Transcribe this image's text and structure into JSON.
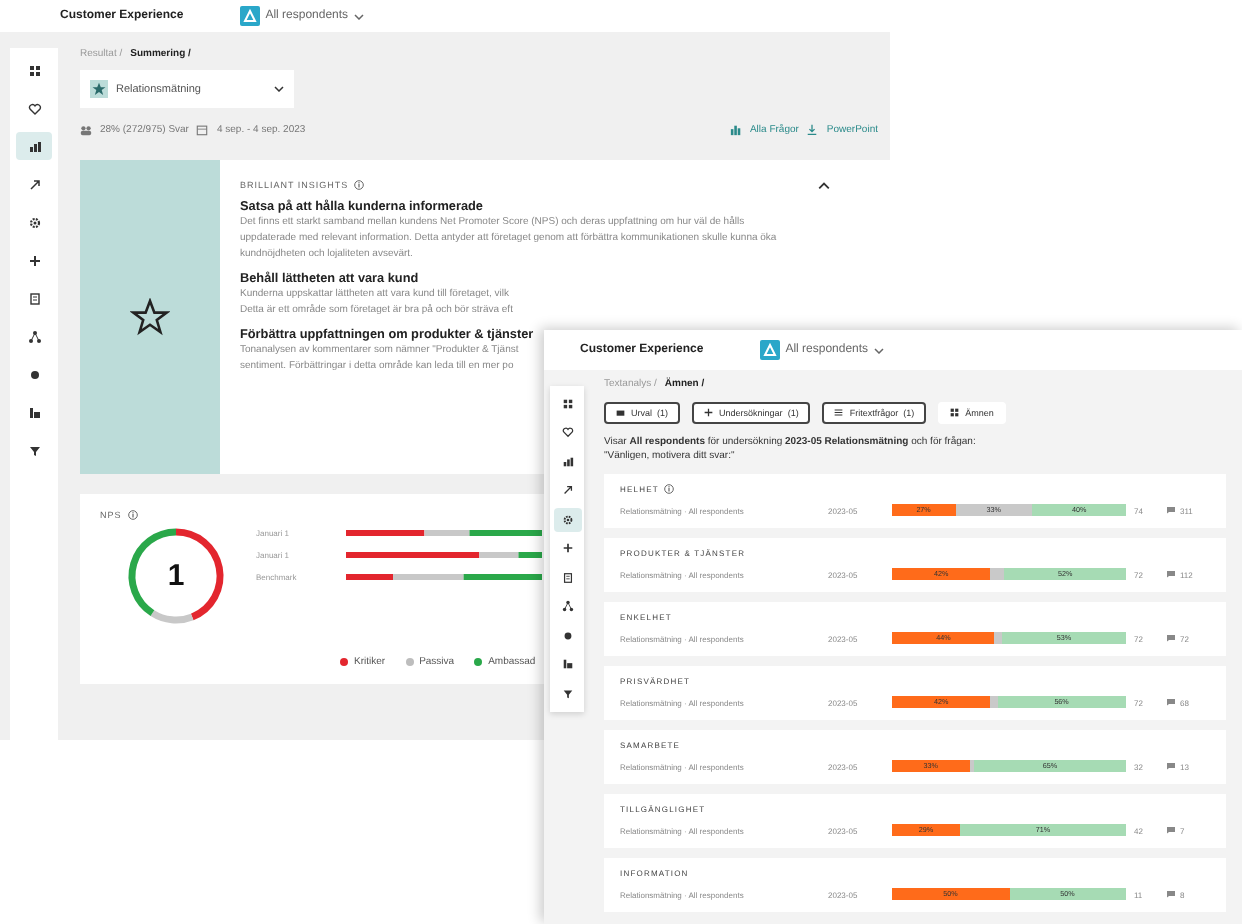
{
  "back_window": {
    "header": {
      "title": "Customer Experience",
      "filter": "All respondents"
    },
    "sidebar": {
      "items": [
        {
          "selected": false
        },
        {
          "selected": false
        },
        {
          "selected": true
        },
        {
          "selected": false
        },
        {
          "selected": false
        },
        {
          "selected": false
        },
        {
          "selected": false
        },
        {
          "selected": false
        },
        {
          "selected": false
        },
        {
          "selected": false
        },
        {
          "selected": false
        }
      ]
    },
    "breadcrumb": [
      {
        "label": "Resultat /",
        "current": false
      },
      {
        "label": "Summering /",
        "current": true
      }
    ],
    "survey_dropdown": {
      "value": "Relationsmätning"
    },
    "meta": {
      "response_rate": "28% (272/975) Svar",
      "date_range": "4 sep. - 4 sep. 2023"
    },
    "actions": [
      "Alla Frågor",
      "PowerPoint"
    ],
    "insights": {
      "title": "BRILLIANT INSIGHTS",
      "expanded": true,
      "sections": [
        {
          "heading": "Satsa på att hålla kunderna informerade",
          "lines": [
            "Det finns ett starkt samband mellan kundens Net Promoter Score (NPS) och deras uppfattning om hur väl de hålls",
            "uppdaterade med relevant information. Detta antyder att företaget genom att förbättra kommunikationen skulle kunna öka",
            "kundnöjdheten och lojaliteten avsevärt."
          ]
        },
        {
          "heading": "Behåll lättheten att vara kund",
          "lines": [
            "Kunderna uppskattar lättheten att vara kund till företaget, vilk",
            "Detta är ett område som företaget är bra på och bör sträva eft"
          ]
        },
        {
          "heading": "Förbättra uppfattningen om produkter & tjänster",
          "lines": [
            "Tonanalysen av kommentarer som nämner \"Produkter & Tjänst",
            "sentiment. Förbättringar i detta område kan leda till en mer po"
          ]
        }
      ]
    },
    "nps": {
      "title": "NPS",
      "score": "1",
      "rows": [
        {
          "label": "Januari 1"
        },
        {
          "label": "Januari 1"
        },
        {
          "label": "Benchmark"
        }
      ],
      "legend": [
        {
          "label": "Kritiker",
          "color": "#e3262e"
        },
        {
          "label": "Passiva",
          "color": "#bdbdbd"
        },
        {
          "label": "Ambassad",
          "color": "#2aa84a"
        }
      ]
    }
  },
  "front_window": {
    "header": {
      "title": "Customer Experience",
      "filter": "All respondents"
    },
    "sidebar": {
      "items": [
        {
          "selected": false
        },
        {
          "selected": false
        },
        {
          "selected": false
        },
        {
          "selected": false
        },
        {
          "selected": true
        },
        {
          "selected": false
        },
        {
          "selected": false
        },
        {
          "selected": false
        },
        {
          "selected": false
        },
        {
          "selected": false
        },
        {
          "selected": false
        }
      ]
    },
    "breadcrumb": [
      {
        "label": "Textanalys /",
        "current": false
      },
      {
        "label": "Ämnen /",
        "current": true
      }
    ],
    "filters": [
      {
        "kind": "filter",
        "label": "Urval",
        "count": "(1)"
      },
      {
        "kind": "filter",
        "label": "Undersökningar",
        "count": "(1)"
      },
      {
        "kind": "filter",
        "label": "Fritextfrågor",
        "count": "(1)"
      },
      {
        "kind": "plain",
        "label": "Ämnen"
      }
    ],
    "description": "Visar **All respondents** för undersökning **2023-05 Relationsmätning** och för frågan:",
    "question": "\"Vänligen, motivera ditt svar:\"",
    "topics": [
      {
        "title": "HELHET",
        "info": true,
        "source": "Relationsmätning · All respondents",
        "date": "2023-05",
        "segments": [
          {
            "kind": "negative",
            "level": 0.27,
            "label": "27%"
          },
          {
            "kind": "neutral",
            "label": "33%"
          },
          {
            "kind": "positive",
            "level": 0.4,
            "label": "40%"
          }
        ],
        "count": "74",
        "comments": "311"
      },
      {
        "title": "PRODUKTER & TJÄNSTER",
        "info": false,
        "source": "Relationsmätning · All respondents",
        "date": "2023-05",
        "segments": [
          {
            "kind": "negative",
            "level": 0.42,
            "label": "42%"
          },
          {
            "kind": "neutral"
          },
          {
            "kind": "positive",
            "level": 0.52,
            "label": "52%"
          }
        ],
        "count": "72",
        "comments": "112"
      },
      {
        "title": "ENKELHET",
        "info": false,
        "source": "Relationsmätning · All respondents",
        "date": "2023-05",
        "segments": [
          {
            "kind": "negative",
            "level": 0.44,
            "label": "44%"
          },
          {
            "kind": "neutral"
          },
          {
            "kind": "positive",
            "level": 0.53,
            "label": "53%"
          }
        ],
        "count": "72",
        "comments": "72"
      },
      {
        "title": "PRISVÄRDHET",
        "info": false,
        "source": "Relationsmätning · All respondents",
        "date": "2023-05",
        "segments": [
          {
            "kind": "negative",
            "level": 0.42,
            "label": "42%"
          },
          {
            "kind": "neutral"
          },
          {
            "kind": "positive",
            "level": 0.55,
            "label": "56%"
          }
        ],
        "count": "72",
        "comments": "68"
      },
      {
        "title": "SAMARBETE",
        "info": false,
        "source": "Relationsmätning · All respondents",
        "date": "2023-05",
        "segments": [
          {
            "kind": "negative",
            "level": 0.33,
            "label": "33%"
          },
          {
            "kind": "neutral"
          },
          {
            "kind": "positive",
            "level": 0.65,
            "label": "65%"
          }
        ],
        "count": "32",
        "comments": "13"
      },
      {
        "title": "TILLGÄNGLIGHET",
        "info": false,
        "source": "Relationsmätning · All respondents",
        "date": "2023-05",
        "segments": [
          {
            "kind": "negative",
            "level": 0.29,
            "label": "29%"
          },
          {
            "kind": "positive",
            "level": 0.71,
            "label": "71%"
          }
        ],
        "count": "42",
        "comments": "7"
      },
      {
        "title": "INFORMATION",
        "info": false,
        "source": "Relationsmätning · All respondents",
        "date": "2023-05",
        "segments": [
          {
            "kind": "negative",
            "level": 0.5,
            "label": "50%"
          },
          {
            "kind": "positive",
            "level": 0.5,
            "label": "50%"
          }
        ],
        "count": "11",
        "comments": "8"
      }
    ]
  }
}
